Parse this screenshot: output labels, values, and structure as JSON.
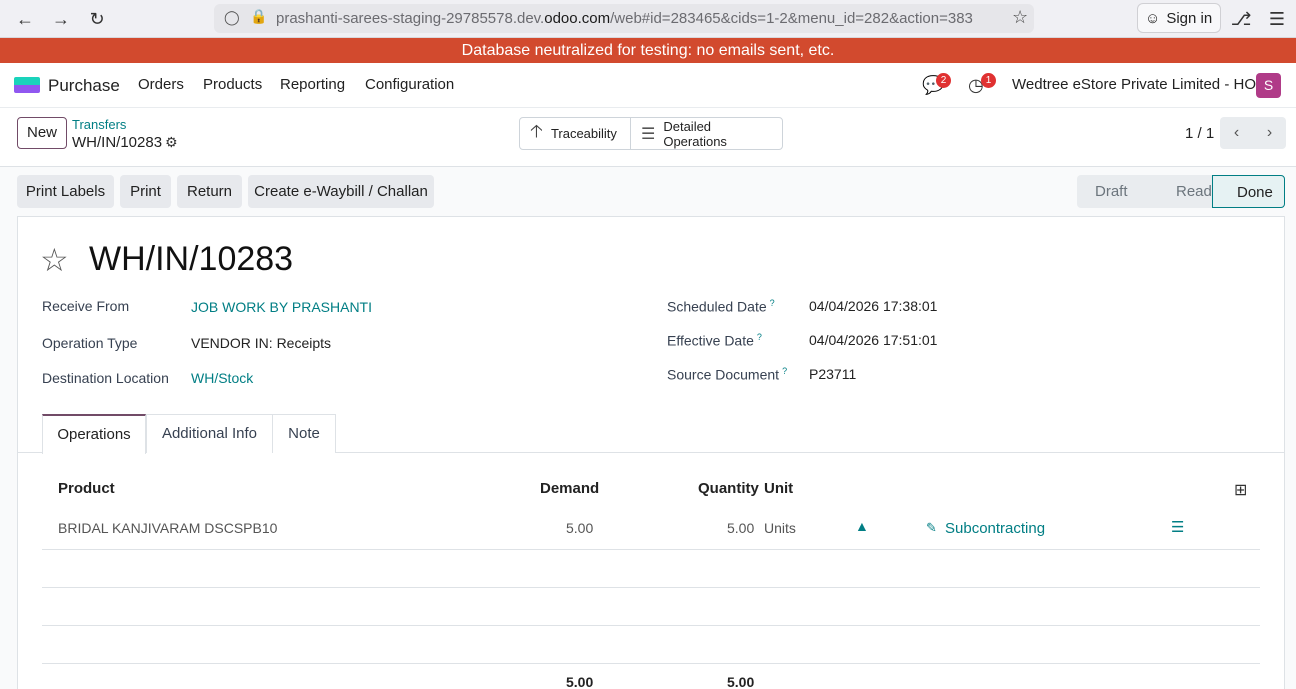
{
  "browser": {
    "url_prefix": "prashanti-sarees-staging-29785578.dev.",
    "url_domain": "odoo.com",
    "url_suffix": "/web#id=283465&cids=1-2&menu_id=282&action=383",
    "sign_in": "Sign in"
  },
  "banner": "Database neutralized for testing: no emails sent, etc.",
  "navbar": {
    "app": "Purchase",
    "menu": [
      "Orders",
      "Products",
      "Reporting",
      "Configuration"
    ],
    "messages_count": "2",
    "activities_count": "1",
    "company": "Wedtree eStore Private Limited - HO",
    "avatar": "S"
  },
  "control": {
    "new_label": "New",
    "breadcrumb_parent": "Transfers",
    "breadcrumb_current": "WH/IN/10283",
    "traceability": "Traceability",
    "detailed_operations": "Detailed Operations",
    "pager": "1 / 1"
  },
  "actions": {
    "print_labels": "Print Labels",
    "print": "Print",
    "return": "Return",
    "ewaybill": "Create e-Waybill / Challan"
  },
  "status": [
    "Draft",
    "Ready",
    "Done"
  ],
  "record": {
    "name": "WH/IN/10283",
    "receive_from_label": "Receive From",
    "receive_from": "JOB WORK BY PRASHANTI",
    "operation_type_label": "Operation Type",
    "operation_type": "VENDOR IN: Receipts",
    "destination_label": "Destination Location",
    "destination": "WH/Stock",
    "scheduled_date_label": "Scheduled Date",
    "scheduled_date": "04/04/2026 17:38:01",
    "effective_date_label": "Effective Date",
    "effective_date": "04/04/2026 17:51:01",
    "source_doc_label": "Source Document",
    "source_doc": "P23711"
  },
  "tabs": [
    "Operations",
    "Additional Info",
    "Note"
  ],
  "table": {
    "headers": {
      "product": "Product",
      "demand": "Demand",
      "quantity": "Quantity",
      "unit": "Unit"
    },
    "rows": [
      {
        "product": "BRIDAL KANJIVARAM DSCSPB10",
        "demand": "5.00",
        "quantity": "5.00",
        "unit": "Units",
        "route": "Subcontracting"
      }
    ],
    "total_demand": "5.00",
    "total_quantity": "5.00"
  }
}
